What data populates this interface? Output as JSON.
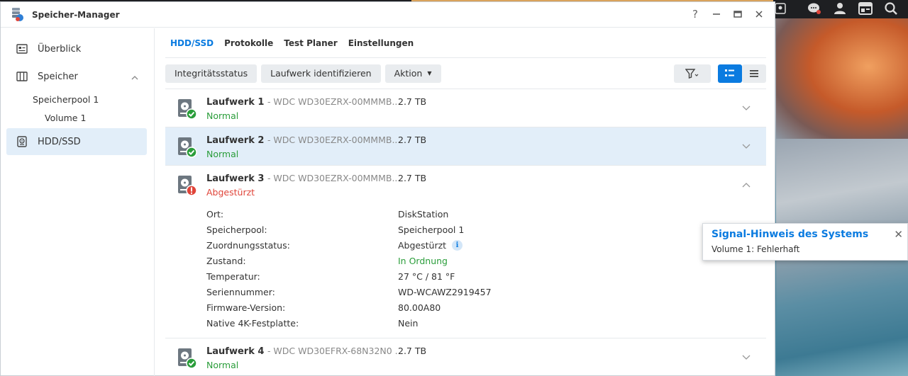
{
  "window": {
    "title": "Speicher-Manager",
    "controls": {
      "help": "?",
      "minimize": "—",
      "maximize": "□",
      "close": "✕"
    }
  },
  "sidebar": {
    "overview": "Überblick",
    "storage": "Speicher",
    "pool": "Speicherpool 1",
    "volume": "Volume 1",
    "hdd": "HDD/SSD"
  },
  "tabs": [
    "HDD/SSD",
    "Protokolle",
    "Test Planer",
    "Einstellungen"
  ],
  "toolbar": {
    "integrity": "Integritätsstatus",
    "identify": "Laufwerk identifizieren",
    "action": "Aktion"
  },
  "drives": [
    {
      "name": "Laufwerk 1",
      "model": "- WDC WD30EZRX-00MMMB...",
      "size": "2.7 TB",
      "status": "Normal"
    },
    {
      "name": "Laufwerk 2",
      "model": "- WDC WD30EZRX-00MMMB...",
      "size": "2.7 TB",
      "status": "Normal"
    },
    {
      "name": "Laufwerk 3",
      "model": "- WDC WD30EZRX-00MMMB...",
      "size": "2.7 TB",
      "status": "Abgestürzt"
    },
    {
      "name": "Laufwerk 4",
      "model": "- WDC WD30EFRX-68N32N0 ...",
      "size": "2.7 TB",
      "status": "Normal"
    }
  ],
  "details": [
    {
      "label": "Ort:",
      "value": "DiskStation"
    },
    {
      "label": "Speicherpool:",
      "value": "Speicherpool 1"
    },
    {
      "label": "Zuordnungsstatus:",
      "value": "Abgestürzt"
    },
    {
      "label": "Zustand:",
      "value": "In Ordnung"
    },
    {
      "label": "Temperatur:",
      "value": "27 °C / 81 °F"
    },
    {
      "label": "Seriennummer:",
      "value": "WD-WCAWZ2919457"
    },
    {
      "label": "Firmware-Version:",
      "value": "80.00A80"
    },
    {
      "label": "Native 4K-Festplatte:",
      "value": "Nein"
    }
  ],
  "notification": {
    "title": "Signal-Hinweis des Systems",
    "message": "Volume 1: Fehlerhaft",
    "close": "✕"
  },
  "colors": {
    "accent": "#0a7be0",
    "ok": "#2a9d3a",
    "error": "#e0453a",
    "selected": "#e2eef9"
  }
}
